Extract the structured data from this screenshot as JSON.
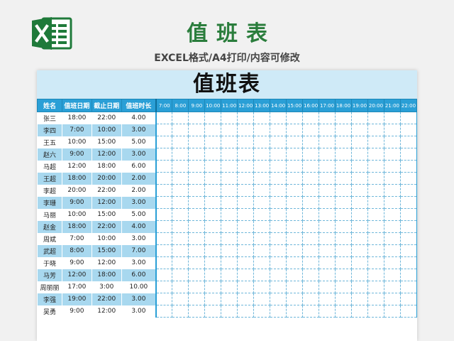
{
  "header": {
    "title": "值班表",
    "subtitle": "EXCEL格式/A4打印/内容可修改",
    "logo_icon": "excel-logo-icon",
    "logo_color": "#1f7a3a"
  },
  "sheet": {
    "title": "值班表",
    "columns": {
      "name": "姓名",
      "start": "值班日期",
      "end": "截止日期",
      "duration": "值班时长"
    },
    "hours": [
      "7:00",
      "8:00",
      "9:00",
      "10:00",
      "11:00",
      "12:00",
      "13:00",
      "14:00",
      "15:00",
      "16:00",
      "17:00",
      "18:00",
      "19:00",
      "20:00",
      "21:00",
      "22:00"
    ],
    "rows": [
      {
        "name": "张三",
        "start": "18:00",
        "end": "22:00",
        "duration": "4.00"
      },
      {
        "name": "李四",
        "start": "7:00",
        "end": "10:00",
        "duration": "3.00"
      },
      {
        "name": "王五",
        "start": "10:00",
        "end": "15:00",
        "duration": "5.00"
      },
      {
        "name": "赵六",
        "start": "9:00",
        "end": "12:00",
        "duration": "3.00"
      },
      {
        "name": "马超",
        "start": "12:00",
        "end": "18:00",
        "duration": "6.00"
      },
      {
        "name": "王超",
        "start": "18:00",
        "end": "20:00",
        "duration": "2.00"
      },
      {
        "name": "李超",
        "start": "20:00",
        "end": "22:00",
        "duration": "2.00"
      },
      {
        "name": "李珊",
        "start": "9:00",
        "end": "12:00",
        "duration": "3.00"
      },
      {
        "name": "马丽",
        "start": "10:00",
        "end": "15:00",
        "duration": "5.00"
      },
      {
        "name": "赵金",
        "start": "18:00",
        "end": "22:00",
        "duration": "4.00"
      },
      {
        "name": "周斌",
        "start": "7:00",
        "end": "10:00",
        "duration": "3.00"
      },
      {
        "name": "武超",
        "start": "8:00",
        "end": "15:00",
        "duration": "7.00"
      },
      {
        "name": "于晓",
        "start": "9:00",
        "end": "12:00",
        "duration": "3.00"
      },
      {
        "name": "马芳",
        "start": "12:00",
        "end": "18:00",
        "duration": "6.00"
      },
      {
        "name": "周丽丽",
        "start": "17:00",
        "end": "3:00",
        "duration": "10.00"
      },
      {
        "name": "李强",
        "start": "19:00",
        "end": "22:00",
        "duration": "3.00"
      },
      {
        "name": "吴勇",
        "start": "9:00",
        "end": "12:00",
        "duration": "3.00"
      }
    ]
  },
  "colors": {
    "header_blue": "#2a9fd6",
    "stripe_blue": "#a8d8ef",
    "title_band": "#cfeaf7",
    "title_green": "#2a7d3c"
  }
}
